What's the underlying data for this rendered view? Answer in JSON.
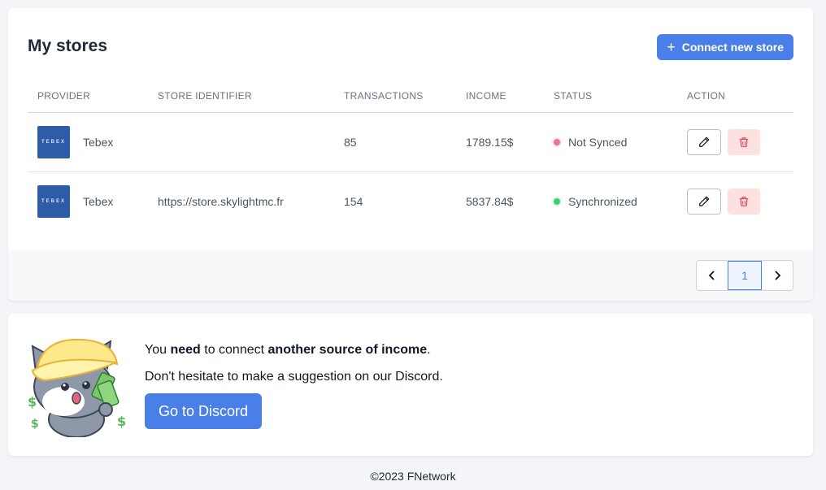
{
  "stores": {
    "title": "My stores",
    "connect_label": "Connect new store",
    "columns": [
      "PROVIDER",
      "STORE IDENTIFIER",
      "TRANSACTIONS",
      "INCOME",
      "STATUS",
      "ACTION"
    ],
    "rows": [
      {
        "provider": "Tebex",
        "logo_text": "TEBEX",
        "identifier": "",
        "transactions": "85",
        "income": "1789.15$",
        "status": "Not Synced",
        "status_color": "#f0718a"
      },
      {
        "provider": "Tebex",
        "logo_text": "TEBEX",
        "identifier": "https://store.skylightmc.fr",
        "transactions": "154",
        "income": "5837.84$",
        "status": "Synchronized",
        "status_color": "#3ecf6e"
      }
    ],
    "pagination": {
      "prev_icon": "chevron-left-icon",
      "current": "1",
      "next_icon": "chevron-right-icon"
    }
  },
  "promo": {
    "line1_a": "You ",
    "line1_b": "need",
    "line1_c": " to connect ",
    "line1_d": "another source of income",
    "line1_e": ".",
    "line2": "Don't hesitate to make a suggestion on our Discord.",
    "button": "Go to Discord"
  },
  "footer": {
    "copyright": "©2023 FNetwork"
  },
  "colors": {
    "accent": "#4a7fe8",
    "danger_bg": "#fde1e1",
    "danger": "#e04a5f"
  }
}
